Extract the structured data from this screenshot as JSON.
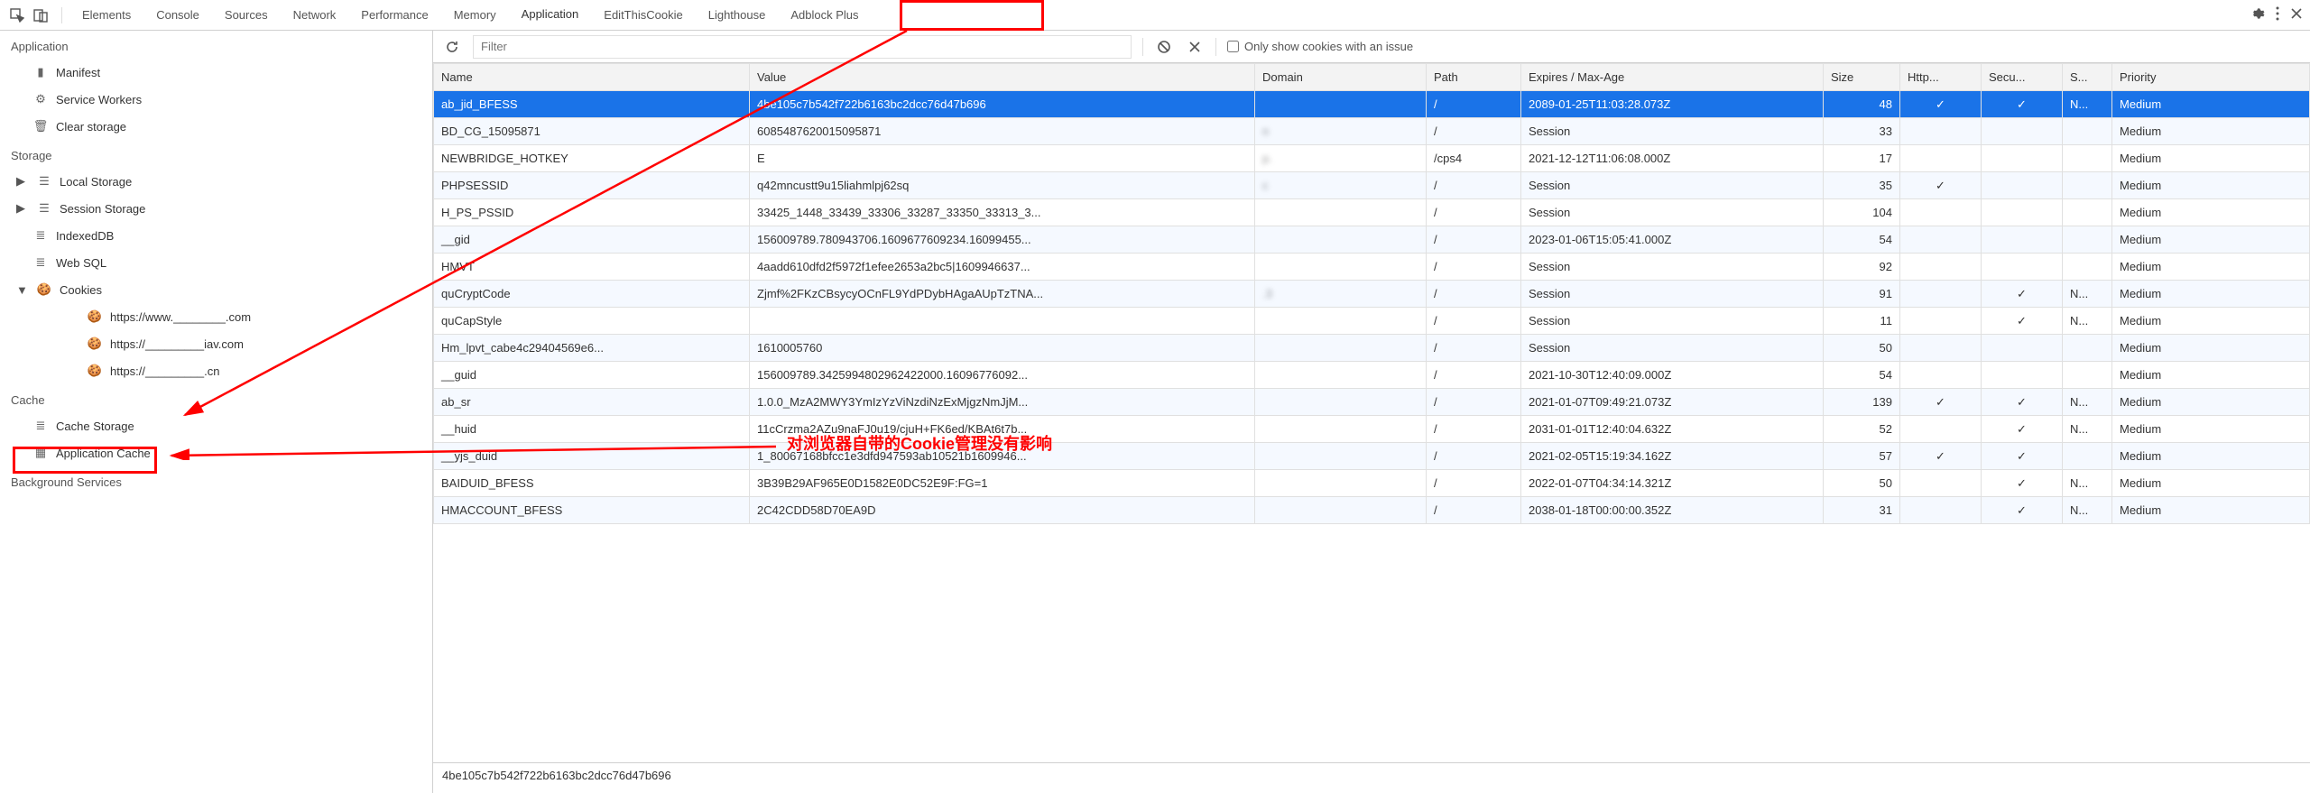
{
  "tabs": [
    "Elements",
    "Console",
    "Sources",
    "Network",
    "Performance",
    "Memory",
    "Application",
    "EditThisCookie",
    "Lighthouse",
    "Adblock Plus"
  ],
  "active_tab": "Application",
  "sidebar": {
    "application": {
      "title": "Application",
      "manifest": "Manifest",
      "service_workers": "Service Workers",
      "clear_storage": "Clear storage"
    },
    "storage": {
      "title": "Storage",
      "local_storage": "Local Storage",
      "session_storage": "Session Storage",
      "indexeddb": "IndexedDB",
      "websql": "Web SQL",
      "cookies": "Cookies",
      "cookie_origins": [
        "https://www.________.com",
        "https://_________iav.com",
        "https://_________.cn"
      ]
    },
    "cache": {
      "title": "Cache",
      "cache_storage": "Cache Storage",
      "app_cache": "Application Cache"
    },
    "bgservices": {
      "title": "Background Services"
    }
  },
  "toolbar": {
    "filter_placeholder": "Filter",
    "only_issues": "Only show cookies with an issue"
  },
  "columns": {
    "name": "Name",
    "value": "Value",
    "domain": "Domain",
    "path": "Path",
    "expires": "Expires / Max-Age",
    "size": "Size",
    "http": "Http...",
    "secure": "Secu...",
    "same": "S...",
    "priority": "Priority"
  },
  "rows": [
    {
      "name": "ab_jid_BFESS",
      "value": "4be105c7b542f722b6163bc2dcc76d47b696",
      "domain": "",
      "path": "/",
      "expires": "2089-01-25T11:03:28.073Z",
      "size": "48",
      "http": "✓",
      "secure": "✓",
      "same": "N...",
      "priority": "Medium",
      "selected": true
    },
    {
      "name": "BD_CG_15095871",
      "value": "6085487620015095871",
      "domain": "n",
      "path": "/",
      "expires": "Session",
      "size": "33",
      "http": "",
      "secure": "",
      "same": "",
      "priority": "Medium"
    },
    {
      "name": "NEWBRIDGE_HOTKEY",
      "value": "E",
      "domain": "p.",
      "path": "/cps4",
      "expires": "2021-12-12T11:06:08.000Z",
      "size": "17",
      "http": "",
      "secure": "",
      "same": "",
      "priority": "Medium"
    },
    {
      "name": "PHPSESSID",
      "value": "q42mncustt9u15liahmlpj62sq",
      "domain": "c",
      "path": "/",
      "expires": "Session",
      "size": "35",
      "http": "✓",
      "secure": "",
      "same": "",
      "priority": "Medium"
    },
    {
      "name": "H_PS_PSSID",
      "value": "33425_1448_33439_33306_33287_33350_33313_3...",
      "domain": "",
      "path": "/",
      "expires": "Session",
      "size": "104",
      "http": "",
      "secure": "",
      "same": "",
      "priority": "Medium"
    },
    {
      "name": "__gid",
      "value": "156009789.780943706.1609677609234.16099455...",
      "domain": "",
      "path": "/",
      "expires": "2023-01-06T15:05:41.000Z",
      "size": "54",
      "http": "",
      "secure": "",
      "same": "",
      "priority": "Medium"
    },
    {
      "name": "HMVT",
      "value": "4aadd610dfd2f5972f1efee2653a2bc5|1609946637...",
      "domain": "",
      "path": "/",
      "expires": "Session",
      "size": "92",
      "http": "",
      "secure": "",
      "same": "",
      "priority": "Medium"
    },
    {
      "name": "quCryptCode",
      "value": "Zjmf%2FKzCBsycyOCnFL9YdPDybHAgaAUpTzTNA...",
      "domain": ".3",
      "path": "/",
      "expires": "Session",
      "size": "91",
      "http": "",
      "secure": "✓",
      "same": "N...",
      "priority": "Medium"
    },
    {
      "name": "quCapStyle",
      "value": "",
      "domain": "",
      "path": "/",
      "expires": "Session",
      "size": "11",
      "http": "",
      "secure": "✓",
      "same": "N...",
      "priority": "Medium"
    },
    {
      "name": "Hm_lpvt_cabe4c29404569e6...",
      "value": "1610005760",
      "domain": "",
      "path": "/",
      "expires": "Session",
      "size": "50",
      "http": "",
      "secure": "",
      "same": "",
      "priority": "Medium"
    },
    {
      "name": "__guid",
      "value": "156009789.3425994802962422000.16096776092...",
      "domain": "",
      "path": "/",
      "expires": "2021-10-30T12:40:09.000Z",
      "size": "54",
      "http": "",
      "secure": "",
      "same": "",
      "priority": "Medium"
    },
    {
      "name": "ab_sr",
      "value": "1.0.0_MzA2MWY3YmIzYzViNzdiNzExMjgzNmJjM...",
      "domain": "",
      "path": "/",
      "expires": "2021-01-07T09:49:21.073Z",
      "size": "139",
      "http": "✓",
      "secure": "✓",
      "same": "N...",
      "priority": "Medium"
    },
    {
      "name": "__huid",
      "value": "11cCrzma2AZu9naFJ0u19/cjuH+FK6ed/KBAt6t7b...",
      "domain": "",
      "path": "/",
      "expires": "2031-01-01T12:40:04.632Z",
      "size": "52",
      "http": "",
      "secure": "✓",
      "same": "N...",
      "priority": "Medium"
    },
    {
      "name": "__yjs_duid",
      "value": "1_80067168bfcc1e3dfd947593ab10521b1609946...",
      "domain": "",
      "path": "/",
      "expires": "2021-02-05T15:19:34.162Z",
      "size": "57",
      "http": "✓",
      "secure": "✓",
      "same": "",
      "priority": "Medium"
    },
    {
      "name": "BAIDUID_BFESS",
      "value": "3B39B29AF965E0D1582E0DC52E9F:FG=1",
      "domain": "",
      "path": "/",
      "expires": "2022-01-07T04:34:14.321Z",
      "size": "50",
      "http": "",
      "secure": "✓",
      "same": "N...",
      "priority": "Medium"
    },
    {
      "name": "HMACCOUNT_BFESS",
      "value": "2C42CDD58D70EA9D",
      "domain": "",
      "path": "/",
      "expires": "2038-01-18T00:00:00.352Z",
      "size": "31",
      "http": "",
      "secure": "✓",
      "same": "N...",
      "priority": "Medium"
    }
  ],
  "footer_value": "4be105c7b542f722b6163bc2dcc76d47b696",
  "annotation": "对浏览器自带的Cookie管理没有影响"
}
